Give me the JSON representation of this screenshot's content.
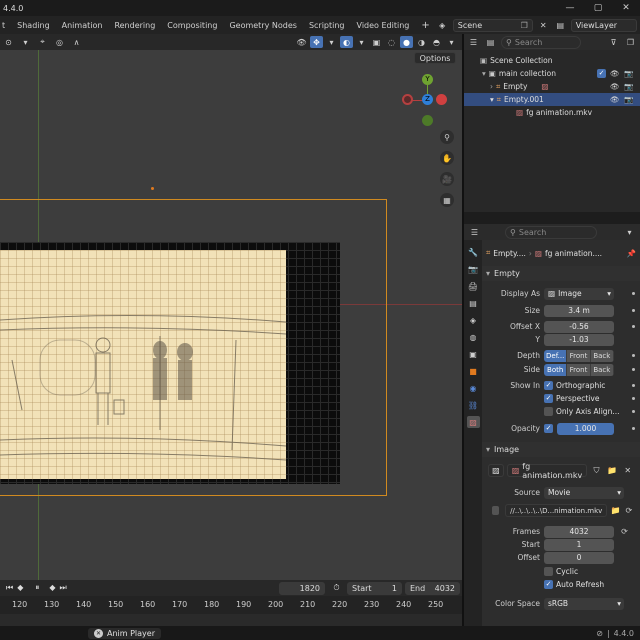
{
  "app": {
    "version_title": "4.4.0",
    "version_status": "4.4.0"
  },
  "window_controls": [
    "—",
    "▢",
    "✕"
  ],
  "workspaces": [
    "t",
    "Shading",
    "Animation",
    "Rendering",
    "Compositing",
    "Geometry Nodes",
    "Scripting",
    "Video Editing"
  ],
  "add_workspace": "+",
  "scene": {
    "name": "Scene",
    "view_layer": "ViewLayer"
  },
  "viewport": {
    "options_label": "Options",
    "gizmo": {
      "y": "Y",
      "z": "Z"
    }
  },
  "outliner": {
    "search_placeholder": "Search",
    "items": [
      {
        "label": "Scene Collection"
      },
      {
        "label": "main collection"
      },
      {
        "label": "Empty"
      },
      {
        "label": "Empty.001"
      },
      {
        "label": "fg animation.mkv"
      }
    ]
  },
  "properties": {
    "search_placeholder": "Search",
    "breadcrumb": {
      "object": "Empty....",
      "data": "fg animation...."
    },
    "empty_panel": {
      "title": "Empty",
      "display_as_label": "Display As",
      "display_as_value": "Image",
      "size_label": "Size",
      "size_value": "3.4 m",
      "offset_x_label": "Offset X",
      "offset_x_value": "-0.56",
      "offset_y_label": "Y",
      "offset_y_value": "-1.03",
      "depth_label": "Depth",
      "depth_options": [
        "Def...",
        "Front",
        "Back"
      ],
      "side_label": "Side",
      "side_options": [
        "Both",
        "Front",
        "Back"
      ],
      "show_in_label": "Show In",
      "show_in_options": [
        "Orthographic",
        "Perspective",
        "Only Axis Align..."
      ],
      "opacity_label": "Opacity",
      "opacity_value": "1.000"
    },
    "image_panel": {
      "title": "Image",
      "image_name": "fg animation.mkv",
      "source_label": "Source",
      "source_value": "Movie",
      "filepath": "//..\\..\\..\\..\\D...nimation.mkv",
      "frames_label": "Frames",
      "frames_value": "4032",
      "start_label": "Start",
      "start_value": "1",
      "offset_label": "Offset",
      "offset_value": "0",
      "cyclic_label": "Cyclic",
      "auto_refresh_label": "Auto Refresh",
      "color_space_label": "Color Space",
      "color_space_value": "sRGB"
    }
  },
  "timeline": {
    "current_frame": "1820",
    "start_label": "Start",
    "start_value": "1",
    "end_label": "End",
    "end_value": "4032",
    "ruler": [
      "120",
      "130",
      "140",
      "150",
      "160",
      "170",
      "180",
      "190",
      "200",
      "210",
      "220",
      "230",
      "240",
      "250"
    ]
  },
  "statusbar": {
    "anim_player": "Anim Player"
  }
}
